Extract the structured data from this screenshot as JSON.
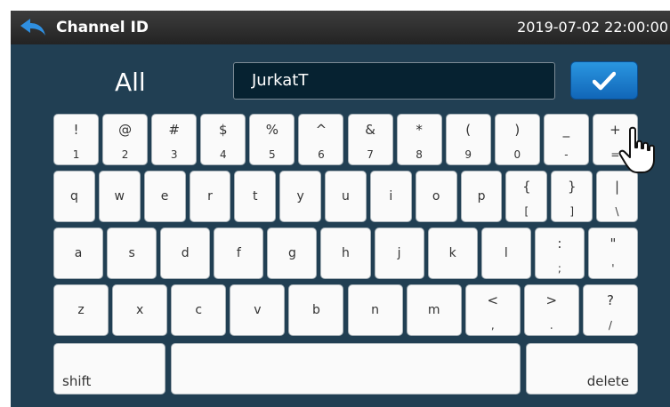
{
  "header": {
    "title": "Channel ID",
    "datetime": "2019-07-02  22:00:00",
    "back_icon": "back-arrow-icon"
  },
  "input": {
    "scope_label": "All",
    "value": "JurkatT",
    "confirm_icon": "checkmark-icon",
    "cursor_icon": "hand-pointer-icon"
  },
  "colors": {
    "header_bg": "#2e2e2e",
    "panel_bg": "#213f53",
    "field_bg": "#062231",
    "confirm_button": "#1a7fd0",
    "key_bg": "#fafafa"
  },
  "keyboard": {
    "rows": [
      [
        [
          "!",
          "1"
        ],
        [
          "@",
          "2"
        ],
        [
          "#",
          "3"
        ],
        [
          "$",
          "4"
        ],
        [
          "%",
          "5"
        ],
        [
          "^",
          "6"
        ],
        [
          "&",
          "7"
        ],
        [
          "*",
          "8"
        ],
        [
          "(",
          "9"
        ],
        [
          ")",
          "0"
        ],
        [
          "_",
          "-"
        ],
        [
          "+",
          "="
        ]
      ],
      [
        [
          "q",
          ""
        ],
        [
          "w",
          ""
        ],
        [
          "e",
          ""
        ],
        [
          "r",
          ""
        ],
        [
          "t",
          ""
        ],
        [
          "y",
          ""
        ],
        [
          "u",
          ""
        ],
        [
          "i",
          ""
        ],
        [
          "o",
          ""
        ],
        [
          "p",
          ""
        ],
        [
          "{",
          "["
        ],
        [
          "}",
          "]"
        ],
        [
          "|",
          "\\"
        ]
      ],
      [
        [
          "a",
          ""
        ],
        [
          "s",
          ""
        ],
        [
          "d",
          ""
        ],
        [
          "f",
          ""
        ],
        [
          "g",
          ""
        ],
        [
          "h",
          ""
        ],
        [
          "j",
          ""
        ],
        [
          "k",
          ""
        ],
        [
          "l",
          ""
        ],
        [
          ":",
          ";"
        ],
        [
          "\"",
          "'"
        ]
      ],
      [
        [
          "z",
          ""
        ],
        [
          "x",
          ""
        ],
        [
          "c",
          ""
        ],
        [
          "v",
          ""
        ],
        [
          "b",
          ""
        ],
        [
          "n",
          ""
        ],
        [
          "m",
          ""
        ],
        [
          "<",
          ","
        ],
        [
          ">",
          "."
        ],
        [
          "?",
          "/"
        ]
      ]
    ],
    "shift_label": "shift",
    "space_label": "",
    "delete_label": "delete"
  }
}
